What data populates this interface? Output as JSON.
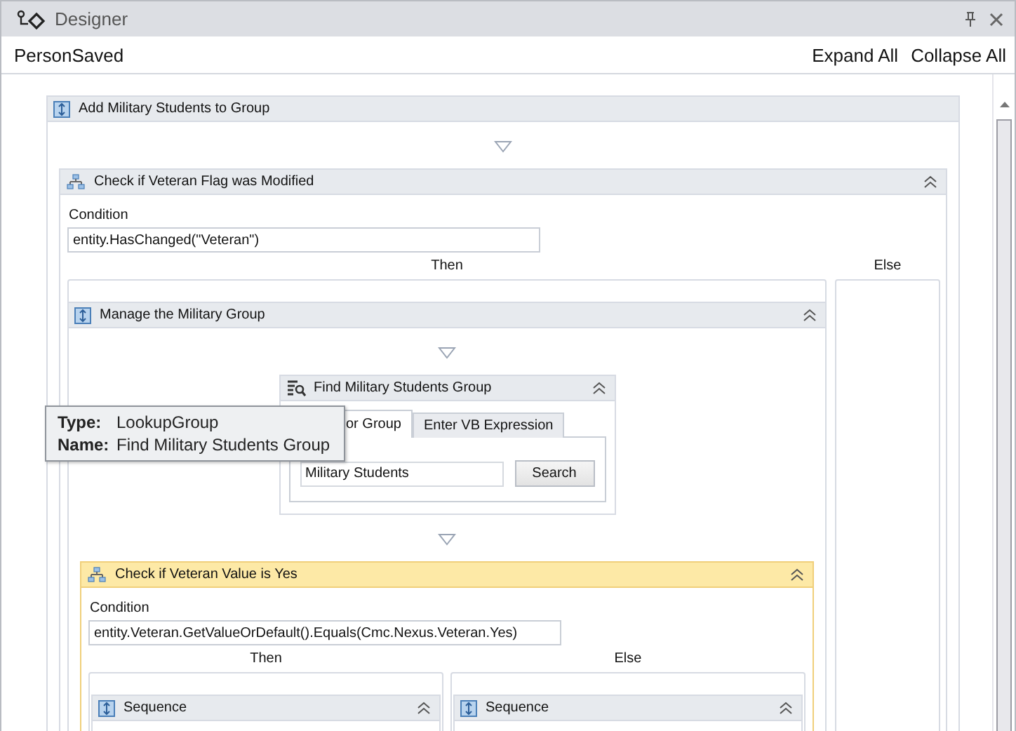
{
  "window": {
    "title": "Designer"
  },
  "toolbar": {
    "breadcrumb": "PersonSaved",
    "links": [
      "Expand All",
      "Collapse All"
    ]
  },
  "workflow": {
    "kind": "sequence",
    "title": "Add Military Students to Group",
    "collapsible": false,
    "selected": false,
    "children": [
      {
        "kind": "if",
        "title": "Check if Veteran Flag was Modified",
        "collapsible": true,
        "selected": false,
        "condition_label": "Condition",
        "condition": "entity.HasChanged(\"Veteran\")",
        "then_label": "Then",
        "else_label": "Else",
        "then": {
          "kind": "sequence",
          "title": "Manage the Military Group",
          "collapsible": true,
          "selected": false,
          "children": [
            {
              "kind": "lookup",
              "title": "Find Military Students Group",
              "collapsible": true,
              "selected": false,
              "tabs": [
                {
                  "label": "or Group",
                  "selected": true
                },
                {
                  "label": "Enter VB Expression",
                  "selected": false
                }
              ],
              "value": "Military Students",
              "button": "Search"
            },
            {
              "kind": "if",
              "title": "Check if Veteran Value is Yes",
              "collapsible": true,
              "selected": true,
              "condition_label": "Condition",
              "condition": "entity.Veteran.GetValueOrDefault().Equals(Cmc.Nexus.Veteran.Yes)",
              "then_label": "Then",
              "else_label": "Else",
              "then": {
                "kind": "sequence",
                "title": "Sequence",
                "collapsible": true,
                "selected": false
              },
              "else": {
                "kind": "sequence",
                "title": "Sequence",
                "collapsible": true,
                "selected": false
              }
            }
          ]
        }
      }
    ]
  },
  "tooltip": {
    "rows": [
      {
        "label": "Type:",
        "value": "LookupGroup"
      },
      {
        "label": "Name:",
        "value": "Find Military Students Group"
      }
    ]
  }
}
